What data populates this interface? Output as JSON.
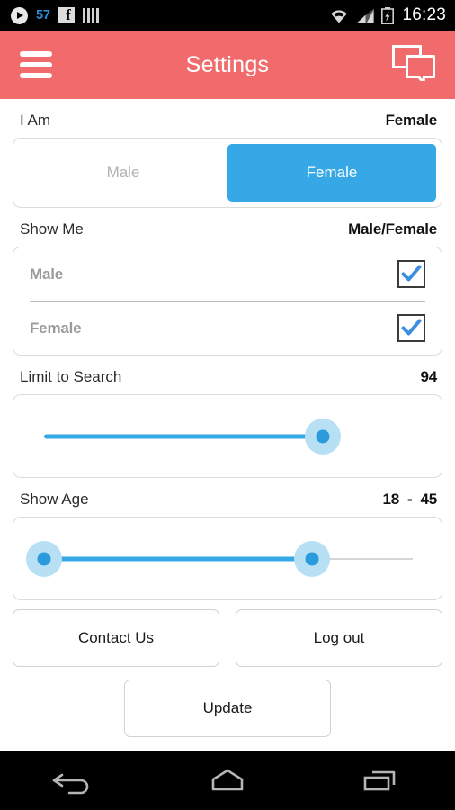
{
  "status_bar": {
    "play_icon": "play-icon",
    "notification_count": "57",
    "facebook_icon": "facebook-icon",
    "bars_icon": "bars-icon",
    "wifi_icon": "wifi-icon",
    "signal_icon": "signal-icon",
    "battery_icon": "battery-charging-icon",
    "time": "16:23",
    "accent_color": "#2a8fd4"
  },
  "app_bar": {
    "menu_icon": "hamburger-menu-icon",
    "title": "Settings",
    "chat_icon": "chat-bubbles-icon",
    "background_color": "#f26b6c"
  },
  "sections": {
    "i_am": {
      "label": "I Am",
      "value": "Female",
      "options": [
        {
          "label": "Male",
          "selected": false
        },
        {
          "label": "Female",
          "selected": true
        }
      ],
      "active_color": "#35a8e5"
    },
    "show_me": {
      "label": "Show Me",
      "value": "Male/Female",
      "options": [
        {
          "label": "Male",
          "checked": true
        },
        {
          "label": "Female",
          "checked": true
        }
      ],
      "check_color": "#3d8ee0"
    },
    "limit_to_search": {
      "label": "Limit to Search",
      "value": "94",
      "min": 0,
      "max": 100,
      "current": 94,
      "track_color": "#35a8e5"
    },
    "show_age": {
      "label": "Show Age",
      "value_min": "18",
      "separator": "-",
      "value_max": "45",
      "min": 18,
      "max": 60,
      "current_min": 18,
      "current_max": 45,
      "track_color": "#35a8e5",
      "inactive_track_color": "#d5d5d5"
    }
  },
  "buttons": {
    "contact_us": "Contact Us",
    "log_out": "Log out",
    "update": "Update"
  },
  "nav_bar": {
    "back_icon": "back-arrow-icon",
    "home_icon": "home-icon",
    "recents_icon": "recent-apps-icon"
  }
}
